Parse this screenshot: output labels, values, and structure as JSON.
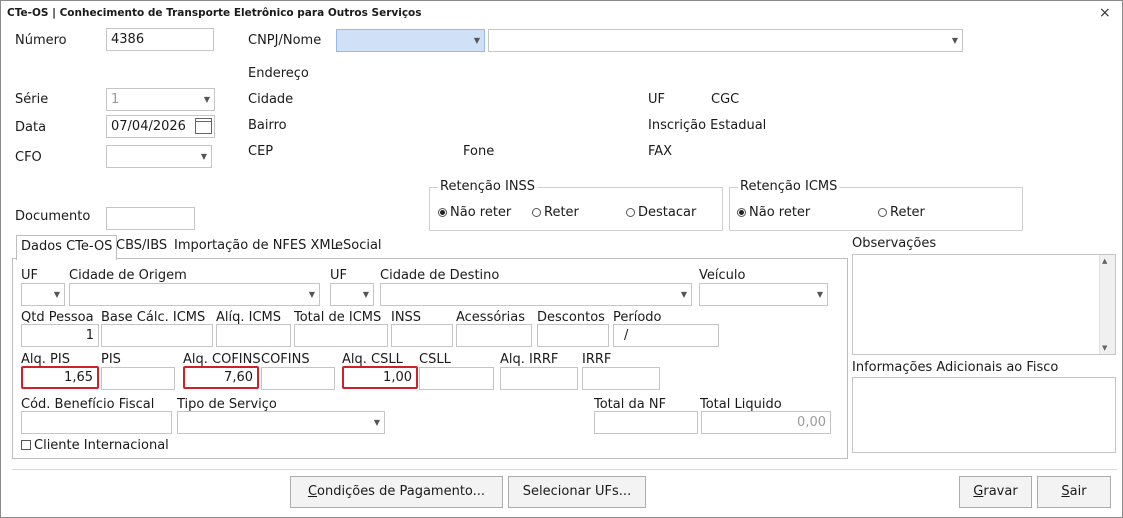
{
  "window": {
    "title": "CTe-OS | Conhecimento de Transporte Eletrônico para Outros Serviços",
    "close": "×"
  },
  "header": {
    "numero_label": "Número",
    "numero_value": "4386",
    "serie_label": "Série",
    "serie_value": "1",
    "data_label": "Data",
    "data_value": "07/04/2026",
    "cfo_label": "CFO",
    "cfo_value": "",
    "documento_label": "Documento",
    "documento_value": "",
    "cnpj_label": "CNPJ/Nome",
    "cnpj_value": "",
    "nome_value": "",
    "endereco_label": "Endereço",
    "cidade_label": "Cidade",
    "bairro_label": "Bairro",
    "cep_label": "CEP",
    "fone_label": "Fone",
    "uf_label": "UF",
    "cgc_label": "CGC",
    "ie_label": "Inscrição Estadual",
    "fax_label": "FAX"
  },
  "retencao_inss": {
    "title": "Retenção INSS",
    "options": [
      "Não reter",
      "Reter",
      "Destacar"
    ],
    "selected": "Não reter"
  },
  "retencao_icms": {
    "title": "Retenção ICMS",
    "options": [
      "Não reter",
      "Reter"
    ],
    "selected": "Não reter"
  },
  "tabs": [
    "Dados CTe-OS",
    "CBS/IBS",
    "Importação de NFES XML",
    "eSocial"
  ],
  "active_tab": "Dados CTe-OS",
  "dados": {
    "uf_origem_label": "UF",
    "cidade_origem_label": "Cidade de Origem",
    "uf_destino_label": "UF",
    "cidade_destino_label": "Cidade de Destino",
    "veiculo_label": "Veículo",
    "qtd_pessoa_label": "Qtd Pessoa",
    "qtd_pessoa_value": "1",
    "base_icms_label": "Base Cálc. ICMS",
    "aliq_icms_label": "Alíq. ICMS",
    "total_icms_label": "Total de ICMS",
    "inss_label": "INSS",
    "acessorias_label": "Acessórias",
    "descontos_label": "Descontos",
    "periodo_label": "Período",
    "periodo_value": "/",
    "aliq_pis_label": "Alq. PIS",
    "aliq_pis_value": "1,65",
    "pis_label": "PIS",
    "aliq_cofins_label": "Alq. COFINS",
    "aliq_cofins_value": "7,60",
    "cofins_label": "COFINS",
    "aliq_csll_label": "Alq. CSLL",
    "aliq_csll_value": "1,00",
    "csll_label": "CSLL",
    "aliq_irrf_label": "Alq. IRRF",
    "irrf_label": "IRRF",
    "cod_beneficio_label": "Cód. Benefício Fiscal",
    "tipo_servico_label": "Tipo de Serviço",
    "total_nf_label": "Total da NF",
    "total_liquido_label": "Total Liquido",
    "total_liquido_value": "0,00",
    "cliente_internacional_label": "Cliente Internacional"
  },
  "observacoes_label": "Observações",
  "info_adicionais_label": "Informações Adicionais ao Fisco",
  "buttons": {
    "condicoes_prefix": "",
    "condicoes_key": "C",
    "condicoes_rest": "ondições de Pagamento...",
    "selecionar": "Selecionar UFs...",
    "gravar_key": "G",
    "gravar_rest": "ravar",
    "sair_key": "S",
    "sair_rest": "air"
  },
  "colors": {
    "accent_selected_field": "#cfe0f7",
    "required_border": "#d0202a"
  },
  "icons": [
    "close-icon",
    "dropdown-arrow-icon",
    "calendar-icon",
    "scroll-up-icon",
    "scroll-down-icon"
  ]
}
